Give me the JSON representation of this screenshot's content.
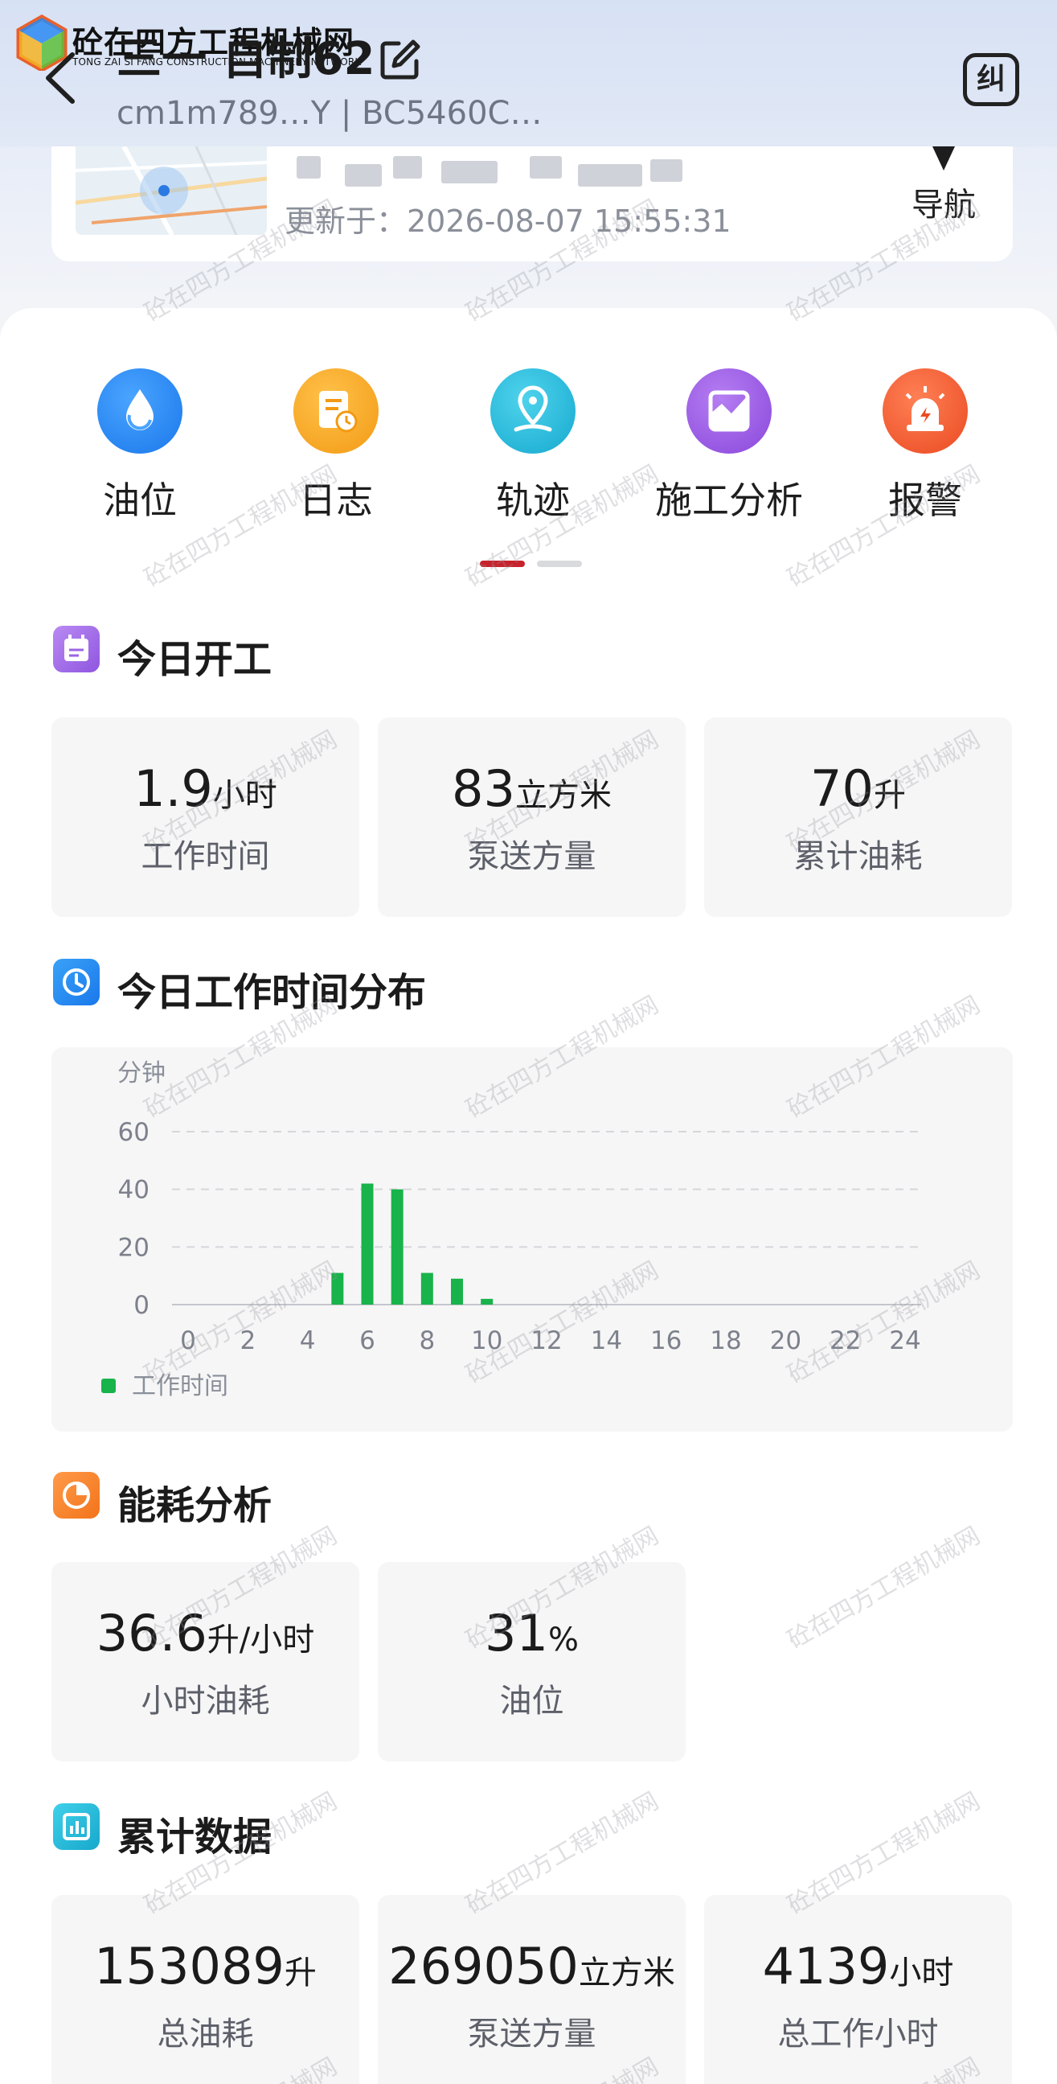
{
  "header": {
    "logo_text": "砼在四方工程机械网",
    "logo_sub": "TONG ZAI SI FANG CONSTRUCTION MACHINERY NETWORK",
    "title": "三一 自制62",
    "sub_line": "cm1m789…Y | BC5460C…",
    "correct_button": "纠"
  },
  "location": {
    "update_time": "更新于：2026-08-07 15:55:31",
    "nav_label": "导航"
  },
  "quick_actions": [
    {
      "label": "油位",
      "icon": "oil-drop-icon",
      "color": "#2a8af2"
    },
    {
      "label": "日志",
      "icon": "log-icon",
      "color": "#f5a623"
    },
    {
      "label": "轨迹",
      "icon": "location-pin-icon",
      "color": "#25b8d8"
    },
    {
      "label": "施工分析",
      "icon": "analysis-icon",
      "color": "#9b59e0"
    },
    {
      "label": "报警",
      "icon": "alarm-icon",
      "color": "#f25a2c"
    }
  ],
  "today_work": {
    "title": "今日开工",
    "stats": [
      {
        "value": "1.9",
        "unit": "小时",
        "label": "工作时间"
      },
      {
        "value": "83",
        "unit": "立方米",
        "label": "泵送方量"
      },
      {
        "value": "70",
        "unit": "升",
        "label": "累计油耗"
      }
    ]
  },
  "time_distribution": {
    "title": "今日工作时间分布",
    "legend": "工作时间"
  },
  "chart_data": {
    "type": "bar",
    "title": "",
    "ylabel": "分钟",
    "xlabel": "",
    "ylim": [
      0,
      60
    ],
    "yticks": [
      0,
      20,
      40,
      60
    ],
    "xticks": [
      0,
      2,
      4,
      6,
      8,
      10,
      12,
      14,
      16,
      18,
      20,
      22,
      24
    ],
    "xlim": [
      0,
      24
    ],
    "grid": true,
    "legend_position": "bottom-left",
    "series": [
      {
        "name": "工作时间",
        "color": "#18b34a",
        "x": [
          5,
          6,
          7,
          8,
          9,
          10
        ],
        "values": [
          11,
          42,
          40,
          11,
          9,
          2
        ]
      }
    ]
  },
  "energy": {
    "title": "能耗分析",
    "stats": [
      {
        "value": "36.6",
        "unit": "升/小时",
        "label": "小时油耗"
      },
      {
        "value": "31",
        "unit": "%",
        "label": "油位"
      }
    ]
  },
  "cumulative": {
    "title": "累计数据",
    "stats": [
      {
        "value": "153089",
        "unit": "升",
        "label": "总油耗"
      },
      {
        "value": "269050",
        "unit": "立方米",
        "label": "泵送方量"
      },
      {
        "value": "4139",
        "unit": "小时",
        "label": "总工作小时"
      }
    ]
  },
  "watermark": "砼在四方工程机械网"
}
